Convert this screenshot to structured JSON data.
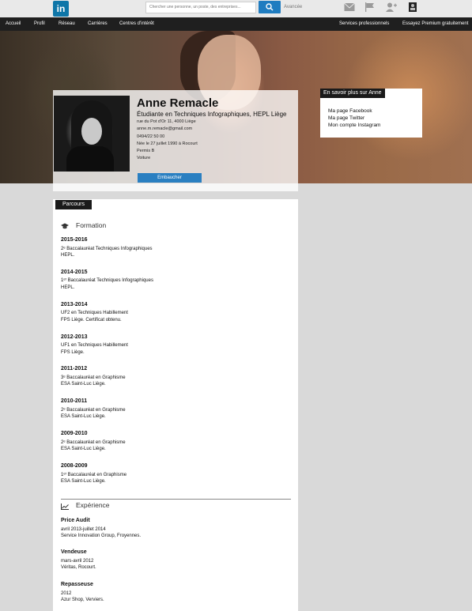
{
  "topbar": {
    "logo": "in",
    "search_placeholder": "Chercher une personne, un poste, des entreprises...",
    "advanced_label": "Avancée",
    "icons": [
      "envelope-icon",
      "flag-icon",
      "add-contact-icon",
      "account-icon"
    ]
  },
  "nav": {
    "items": [
      "Accueil",
      "Profil",
      "Réseau",
      "Carrières",
      "Centres d'intérêt",
      "Services professionnels",
      "Essayez Premium gratuitement"
    ]
  },
  "profile": {
    "name": "Anne Remacle",
    "headline": "Étudiante en Techniques Infographiques, HEPL Liège",
    "address": "rue du Pot d'Or 11, 4000 Liège",
    "email": "anne.m.remacle@gmail.com",
    "phone": "0494/22 50 00",
    "birth": "Née le 27 juillet 1990 à Rocourt",
    "license": "Permis B",
    "car": "Voiture",
    "hire_button": "Embaucher"
  },
  "about": {
    "title": "En savoir plus sur Anne",
    "links": [
      "Ma page Facebook",
      "Ma page Twitter",
      "Mon compte Instagram"
    ]
  },
  "main": {
    "tab": "Parcours",
    "education_title": "Formation",
    "education": [
      {
        "years": "2015-2016",
        "line1": "2ᵉ Baccalauréat Techniques Infographiques",
        "line2": "HEPL."
      },
      {
        "years": "2014-2015",
        "line1": "1ᵉʳ Baccalauréat Techniques Infographiques",
        "line2": "HEPL."
      },
      {
        "years": "2013-2014",
        "line1": "UF2 en Techniques Habillement",
        "line2": "FPS Liège. Certificat obtenu."
      },
      {
        "years": "2012-2013",
        "line1": "UF1 en Techniques Habillement",
        "line2": "FPS Liège."
      },
      {
        "years": "2011-2012",
        "line1": "3ᵉ Baccalauréat en Graphisme",
        "line2": "ESA Saint-Luc Liège."
      },
      {
        "years": "2010-2011",
        "line1": "2ᵉ Baccalauréat en Graphisme",
        "line2": "ESA Saint-Luc Liège."
      },
      {
        "years": "2009-2010",
        "line1": "2ᵉ Baccalauréat en Graphisme",
        "line2": "ESA Saint-Luc Liège."
      },
      {
        "years": "2008-2009",
        "line1": "1ᵉʳ Baccalauréat en Graphisme",
        "line2": "ESA Saint-Luc Liège."
      }
    ],
    "experience_title": "Expérience",
    "experience": [
      {
        "title": "Price Audit",
        "dates": "avril 2013-juillet 2014",
        "place": "Service Innovation Group, Froyennes."
      },
      {
        "title": "Vendeuse",
        "dates": "mars-avril 2012",
        "place": "Véritas, Rocourt."
      },
      {
        "title": "Repasseuse",
        "dates": "2012",
        "place": "Azur Shop, Verviers."
      }
    ]
  }
}
